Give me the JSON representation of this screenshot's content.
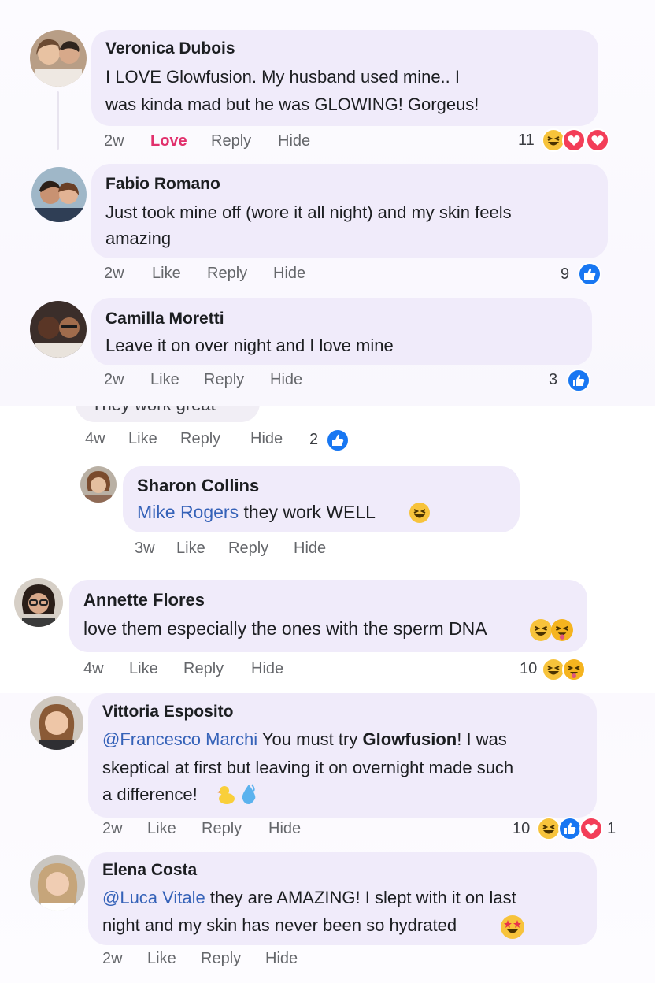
{
  "comments": {
    "veronica": {
      "name": "Veronica Dubois",
      "line1": "I LOVE Glowfusion. My husband used mine.. I",
      "line2": "was kinda mad but he was GLOWING! Gorgeus!",
      "time": "2w",
      "react": "Love",
      "reply": "Reply",
      "hide": "Hide",
      "count": "11"
    },
    "fabio": {
      "name": "Fabio Romano",
      "line1": "Just took mine off (wore it all night) and my skin feels",
      "line2": "amazing",
      "time": "2w",
      "like": "Like",
      "reply": "Reply",
      "hide": "Hide",
      "count": "9"
    },
    "camilla": {
      "name": "Camilla Moretti",
      "line1": "Leave it on over night and I love mine",
      "time": "2w",
      "like": "Like",
      "reply": "Reply",
      "hide": "Hide",
      "count": "3"
    },
    "partial": {
      "clipped_text": "They work great",
      "time": "4w",
      "like": "Like",
      "reply": "Reply",
      "hide": "Hide",
      "count": "2"
    },
    "sharon": {
      "name": "Sharon Collins",
      "mention": "Mike Rogers",
      "text": " they work WELL",
      "time": "3w",
      "like": "Like",
      "reply": "Reply",
      "hide": "Hide"
    },
    "annette": {
      "name": "Annette Flores",
      "line1": "love them especially the ones with the sperm DNA",
      "time": "4w",
      "like": "Like",
      "reply": "Reply",
      "hide": "Hide",
      "count": "10"
    },
    "vittoria": {
      "name": "Vittoria Esposito",
      "mention": "@Francesco Marchi",
      "text_a": " You must try ",
      "brand": "Glowfusion",
      "text_b": "! I was",
      "line2": "skeptical at first but leaving it on overnight made such",
      "line3": "a difference!",
      "time": "2w",
      "like": "Like",
      "reply": "Reply",
      "hide": "Hide",
      "count": "10",
      "count2": "1"
    },
    "elena": {
      "name": "Elena Costa",
      "mention": "@Luca Vitale",
      "text_a": " they are AMAZING! I slept with it on last",
      "line2": "night and my skin has never been so hydrated",
      "time": "2w",
      "like": "Like",
      "reply": "Reply",
      "hide": "Hide"
    }
  },
  "colors": {
    "bubble": "#f0ebfa",
    "love": "#e1306c",
    "mention": "#3562b8",
    "like_blue": "#1877f2",
    "heart_red": "#f33e58",
    "haha_yellow": "#f7c33b"
  },
  "icons": [
    "haha-emoji",
    "heart-reaction",
    "like-reaction",
    "grinning-squint-emoji",
    "star-struck-emoji",
    "duck-emoji",
    "droplet-emoji"
  ]
}
